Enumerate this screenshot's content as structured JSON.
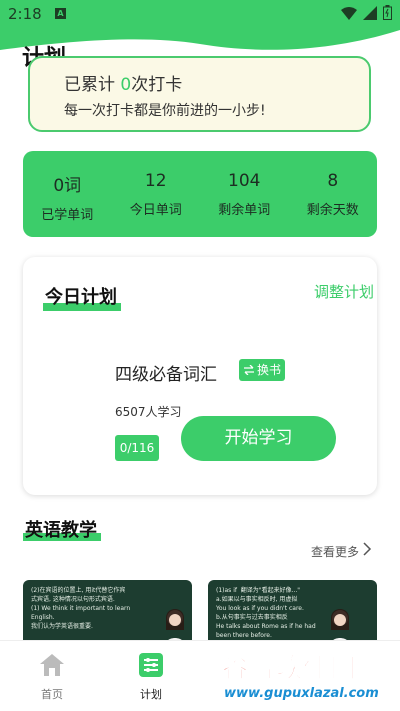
{
  "status_bar": {
    "time": "2:18",
    "notification_badge": "A"
  },
  "page": {
    "title": "计划"
  },
  "checkin": {
    "prefix": "已累计 ",
    "count": "0",
    "suffix": "次打卡",
    "motto": "每一次打卡都是你前进的一小步!"
  },
  "stats": [
    {
      "value": "0词",
      "label": "已学单词"
    },
    {
      "value": "12",
      "label": "今日单词"
    },
    {
      "value": "104",
      "label": "剩余单词"
    },
    {
      "value": "8",
      "label": "剩余天数"
    }
  ],
  "today_plan": {
    "title": "今日计划",
    "adjust_label": "调整计划",
    "book_name": "四级必备词汇",
    "change_book_label": "换书",
    "learners": "6507人学习",
    "progress": "0/116",
    "start_label": "开始学习"
  },
  "english_teaching": {
    "title": "英语教学",
    "see_more_label": "查看更多",
    "videos": [
      {
        "board_text": "(2)在宾语的位置上, 用it代替它作宾\n式宾语, 这种情况以句形式宾语.\n(1) We think it important to learn\nEnglish.\n我们认为学英语很重要."
      },
      {
        "board_text": "(1)as if  翻译为\"看起来好像...\"\na.如果以与事实相反时, 用虚拟\nYou look as if you didn't care.\nb.从句事实与过去事实相反\nHe talks about Rome as if he had\nbeen there before."
      }
    ]
  },
  "bottom_nav": [
    {
      "label": "首页",
      "icon": "home-icon"
    },
    {
      "label": "计划",
      "icon": "plan-icon"
    }
  ],
  "watermark": {
    "title": "谷普软件园",
    "url": "www.gupuxlazal.com"
  },
  "colors": {
    "accent": "#3ccd6a",
    "card_bg": "#fbf9e6",
    "watermark_red": "#e8473a",
    "watermark_blue": "#1a8ed3"
  }
}
